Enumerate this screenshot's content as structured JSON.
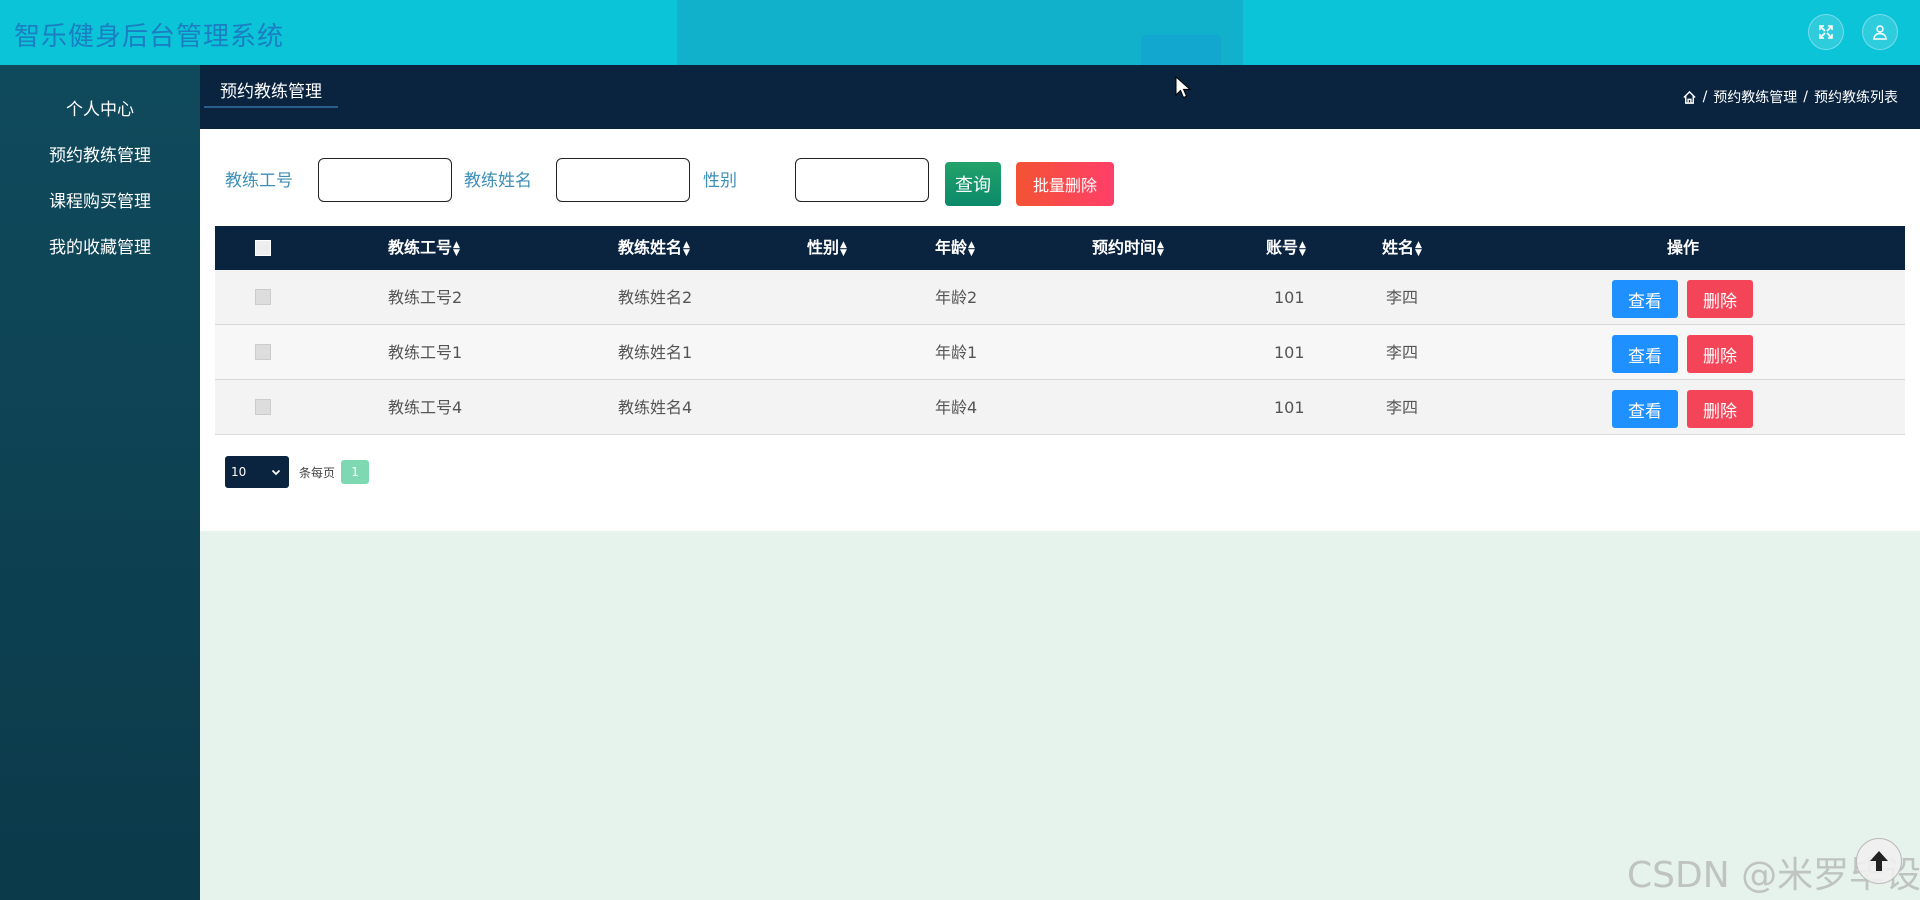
{
  "header": {
    "title": "智乐健身后台管理系统"
  },
  "sidebar": {
    "items": [
      {
        "label": "个人中心"
      },
      {
        "label": "预约教练管理"
      },
      {
        "label": "课程购买管理"
      },
      {
        "label": "我的收藏管理"
      }
    ]
  },
  "topbar": {
    "tab_label": "预约教练管理",
    "breadcrumb": [
      "预约教练管理",
      "预约教练列表"
    ],
    "separator": "/"
  },
  "search": {
    "fields": [
      {
        "label": "教练工号",
        "value": ""
      },
      {
        "label": "教练姓名",
        "value": ""
      },
      {
        "label": "性别",
        "value": ""
      }
    ],
    "query_label": "查询",
    "batch_delete_label": "批量删除"
  },
  "table": {
    "columns": [
      "教练工号",
      "教练姓名",
      "性别",
      "年龄",
      "预约时间",
      "账号",
      "姓名",
      "操作"
    ],
    "rows": [
      {
        "coach_no": "教练工号2",
        "coach_name": "教练姓名2",
        "gender": "",
        "age": "年龄2",
        "time": "",
        "account": "101",
        "name": "李四"
      },
      {
        "coach_no": "教练工号1",
        "coach_name": "教练姓名1",
        "gender": "",
        "age": "年龄1",
        "time": "",
        "account": "101",
        "name": "李四"
      },
      {
        "coach_no": "教练工号4",
        "coach_name": "教练姓名4",
        "gender": "",
        "age": "年龄4",
        "time": "",
        "account": "101",
        "name": "李四"
      }
    ],
    "view_label": "查看",
    "delete_label": "删除"
  },
  "pager": {
    "page_size": "10",
    "per_page_label": "条每页",
    "current_page": "1"
  },
  "watermark": "CSDN @米罗毕设",
  "colors": {
    "header": "#0bc4d7",
    "sidebar": "#0f4a5c",
    "topbar": "#0a2440",
    "view": "#1e90ff",
    "delete": "#f44458"
  }
}
